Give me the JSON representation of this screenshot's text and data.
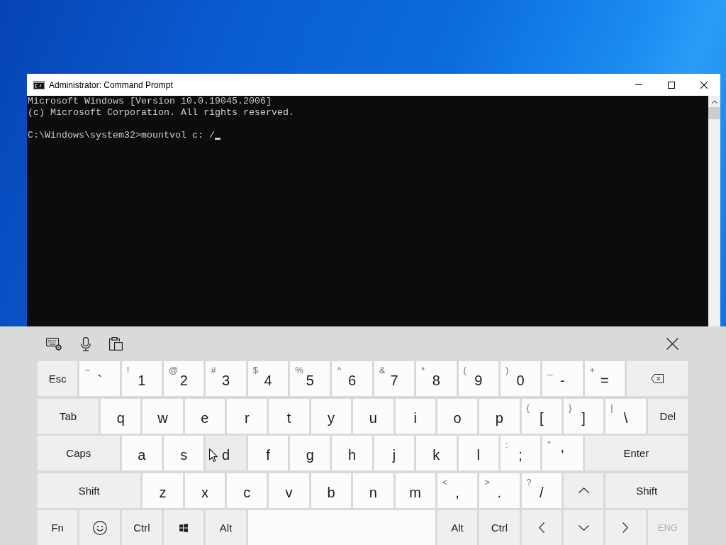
{
  "window": {
    "title": "Administrator: Command Prompt"
  },
  "console": {
    "lines": [
      "Microsoft Windows [Version 10.0.19045.2006]",
      "(c) Microsoft Corporation. All rights reserved."
    ],
    "command_line": "C:\\Windows\\system32>mountvol c: /"
  },
  "keyboard": {
    "rows": [
      {
        "keys": [
          {
            "kind": "function",
            "label": "Esc",
            "hovered": false
          },
          {
            "kind": "char",
            "label": "`",
            "shift": "~",
            "hovered": false
          },
          {
            "kind": "char",
            "label": "1",
            "shift": "!",
            "hovered": false
          },
          {
            "kind": "char",
            "label": "2",
            "shift": "@",
            "hovered": false
          },
          {
            "kind": "char",
            "label": "3",
            "shift": "#",
            "hovered": false
          },
          {
            "kind": "char",
            "label": "4",
            "shift": "$",
            "hovered": false
          },
          {
            "kind": "char",
            "label": "5",
            "shift": "%",
            "hovered": false
          },
          {
            "kind": "char",
            "label": "6",
            "shift": "^",
            "hovered": false
          },
          {
            "kind": "char",
            "label": "7",
            "shift": "&",
            "hovered": false
          },
          {
            "kind": "char",
            "label": "8",
            "shift": "*",
            "hovered": false
          },
          {
            "kind": "char",
            "label": "9",
            "shift": "(",
            "hovered": false
          },
          {
            "kind": "char",
            "label": "0",
            "shift": ")",
            "hovered": false
          },
          {
            "kind": "char",
            "label": "-",
            "shift": "_",
            "hovered": false
          },
          {
            "kind": "char",
            "label": "=",
            "shift": "+",
            "hovered": false
          },
          {
            "kind": "backspace",
            "hovered": false
          }
        ]
      },
      {
        "keys": [
          {
            "kind": "function",
            "label": "Tab",
            "hovered": false
          },
          {
            "kind": "char",
            "label": "q",
            "hovered": false
          },
          {
            "kind": "char",
            "label": "w",
            "hovered": false
          },
          {
            "kind": "char",
            "label": "e",
            "hovered": false
          },
          {
            "kind": "char",
            "label": "r",
            "hovered": false
          },
          {
            "kind": "char",
            "label": "t",
            "hovered": false
          },
          {
            "kind": "char",
            "label": "y",
            "hovered": false
          },
          {
            "kind": "char",
            "label": "u",
            "hovered": false
          },
          {
            "kind": "char",
            "label": "i",
            "hovered": false
          },
          {
            "kind": "char",
            "label": "o",
            "hovered": false
          },
          {
            "kind": "char",
            "label": "p",
            "hovered": false
          },
          {
            "kind": "char",
            "label": "[",
            "shift": "{",
            "hovered": false
          },
          {
            "kind": "char",
            "label": "]",
            "shift": "}",
            "hovered": false
          },
          {
            "kind": "char",
            "label": "\\",
            "shift": "|",
            "hovered": false
          },
          {
            "kind": "function",
            "label": "Del",
            "hovered": false
          }
        ]
      },
      {
        "keys": [
          {
            "kind": "function",
            "label": "Caps",
            "hovered": false
          },
          {
            "kind": "char",
            "label": "a",
            "hovered": false
          },
          {
            "kind": "char",
            "label": "s",
            "hovered": false
          },
          {
            "kind": "char",
            "label": "d",
            "hovered": true
          },
          {
            "kind": "char",
            "label": "f",
            "hovered": false
          },
          {
            "kind": "char",
            "label": "g",
            "hovered": false
          },
          {
            "kind": "char",
            "label": "h",
            "hovered": false
          },
          {
            "kind": "char",
            "label": "j",
            "hovered": false
          },
          {
            "kind": "char",
            "label": "k",
            "hovered": false
          },
          {
            "kind": "char",
            "label": "l",
            "hovered": false
          },
          {
            "kind": "char",
            "label": ";",
            "shift": ":",
            "hovered": false
          },
          {
            "kind": "char",
            "label": "'",
            "shift": "\"",
            "hovered": false
          },
          {
            "kind": "function",
            "label": "Enter",
            "hovered": false
          }
        ]
      },
      {
        "keys": [
          {
            "kind": "function",
            "label": "Shift",
            "hovered": false
          },
          {
            "kind": "char",
            "label": "z",
            "hovered": false
          },
          {
            "kind": "char",
            "label": "x",
            "hovered": false
          },
          {
            "kind": "char",
            "label": "c",
            "hovered": false
          },
          {
            "kind": "char",
            "label": "v",
            "hovered": false
          },
          {
            "kind": "char",
            "label": "b",
            "hovered": false
          },
          {
            "kind": "char",
            "label": "n",
            "hovered": false
          },
          {
            "kind": "char",
            "label": "m",
            "hovered": false
          },
          {
            "kind": "char",
            "label": ",",
            "shift": "<",
            "hovered": false
          },
          {
            "kind": "char",
            "label": ".",
            "shift": ">",
            "hovered": false
          },
          {
            "kind": "char",
            "label": "/",
            "shift": "?",
            "hovered": false
          },
          {
            "kind": "up",
            "hovered": false
          },
          {
            "kind": "function",
            "label": "Shift",
            "hovered": false
          }
        ]
      },
      {
        "keys": [
          {
            "kind": "function",
            "label": "Fn",
            "hovered": false
          },
          {
            "kind": "emoji",
            "hovered": false
          },
          {
            "kind": "function",
            "label": "Ctrl",
            "hovered": false
          },
          {
            "kind": "windows",
            "hovered": false
          },
          {
            "kind": "function",
            "label": "Alt",
            "hovered": false
          },
          {
            "kind": "space",
            "hovered": false
          },
          {
            "kind": "function",
            "label": "Alt",
            "hovered": false
          },
          {
            "kind": "function",
            "label": "Ctrl",
            "hovered": false
          },
          {
            "kind": "left",
            "hovered": false
          },
          {
            "kind": "down",
            "hovered": false
          },
          {
            "kind": "right",
            "hovered": false
          },
          {
            "kind": "language",
            "label": "ENG",
            "hovered": false
          }
        ]
      }
    ]
  }
}
